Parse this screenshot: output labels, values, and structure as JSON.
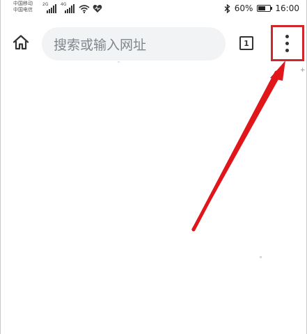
{
  "status_bar": {
    "carrier_1": "中国移动",
    "carrier_2": "中国电信",
    "network_1": "2G",
    "network_2": "4G",
    "battery_percent": "60%",
    "battery_level": 0.6,
    "time": "16:00",
    "icons": [
      "signal-icon",
      "wifi-icon",
      "heart-icon",
      "bluetooth-icon",
      "battery-icon"
    ]
  },
  "toolbar": {
    "home_icon": "home-icon",
    "search_placeholder": "搜索或输入网址",
    "tab_count": "1",
    "menu_icon": "more-vertical-icon"
  },
  "annotation": {
    "highlight_color": "#d0262c",
    "arrow_color": "#e0161b"
  }
}
